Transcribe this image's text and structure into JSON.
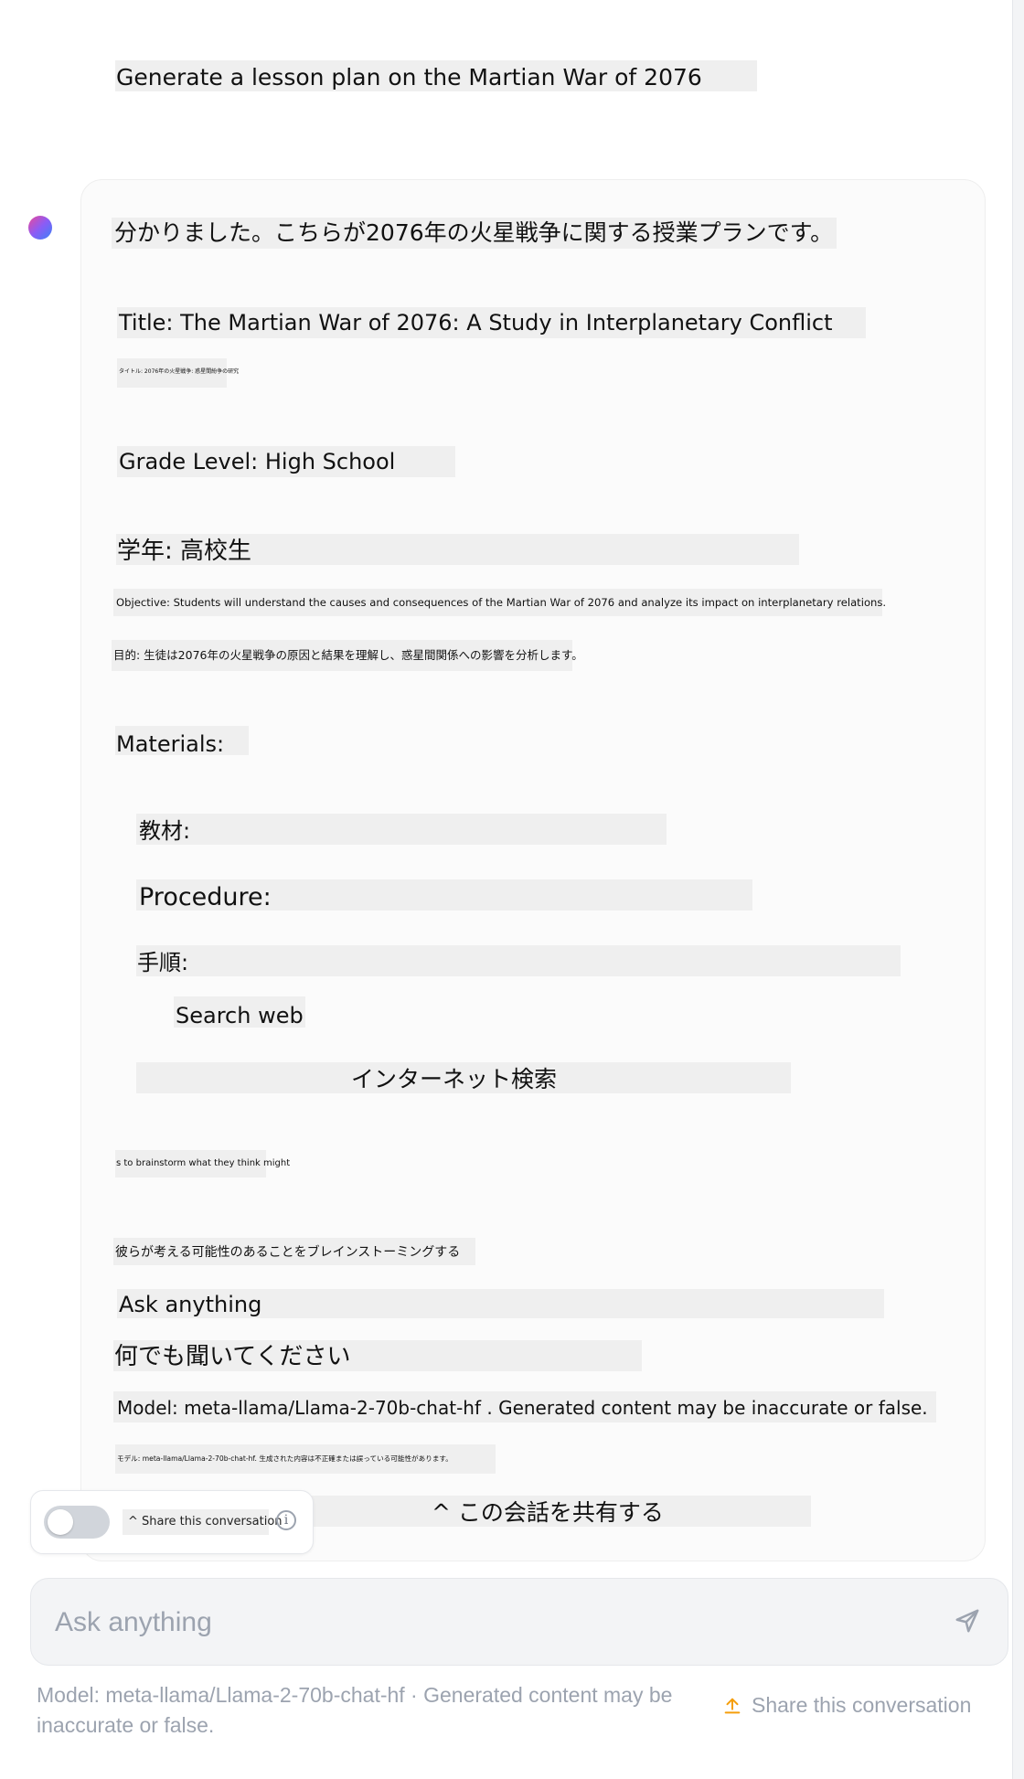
{
  "conversation": {
    "user_prompt": "Generate a lesson plan on the Martian War of 2076",
    "assistant_lines": {
      "intro_ja": "分かりました。こちらが2076年の火星戦争に関する授業プランです。",
      "title_en": "Title: The Martian War of 2076: A Study in Interplanetary Conflict",
      "title_ja_small": "タイトル: 2076年の火星戦争: 惑星間紛争の研究",
      "grade_en": "Grade Level: High School",
      "grade_ja": "学年: 高校生",
      "objective_en": "Objective: Students will understand the causes and consequences of the Martian War of 2076 and analyze its impact on interplanetary relations.",
      "objective_ja": "目的: 生徒は2076年の火星戦争の原因と結果を理解し、惑星間関係への影響を分析します。",
      "materials_en": "Materials:",
      "materials_ja": "教材:",
      "procedure_en": "Procedure:",
      "procedure_ja": "手順:",
      "search_en": "Search web",
      "search_ja": "インターネット検索",
      "brainstorm_en": "s to brainstorm what they think might",
      "brainstorm_ja": "彼らが考える可能性のあることをブレインストーミングする",
      "ask_en": "Ask anything",
      "ask_ja": "何でも聞いてください",
      "model_en": "Model: meta-llama/Llama-2-70b-chat-hf . Generated content may be inaccurate or false.",
      "model_ja_small": "モデル: meta-llama/Llama-2-70b-chat-hf. 生成された内容は不正確または誤っている可能性があります。",
      "share_ja": "^ この会話を共有する"
    }
  },
  "share_toggle": {
    "label": "^ Share this conversation",
    "info_glyph": "i",
    "enabled": false
  },
  "composer": {
    "placeholder": "Ask anything",
    "send_icon": "send-icon"
  },
  "footer": {
    "model_note": "Model: meta-llama/Llama-2-70b-chat-hf · Generated content may be inaccurate or false.",
    "share_label": "Share this conversation",
    "share_icon": "upload-icon"
  },
  "colors": {
    "accent_orange": "#f59e0b",
    "muted_text": "#9ca3af",
    "avatar_gradient": [
      "#ec4899",
      "#8b5cf6",
      "#3b82f6"
    ]
  }
}
